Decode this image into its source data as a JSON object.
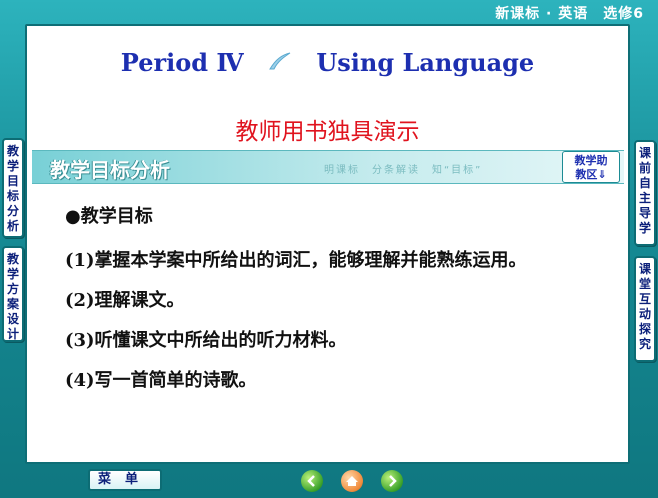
{
  "header": {
    "text": "新课标 · 英语　选修6"
  },
  "title": {
    "left": "Period Ⅳ",
    "right": "Using Language"
  },
  "subtitle": "教师用书独具演示",
  "banner": {
    "title": "教学目标分析",
    "sub": "明课标　分条解读　知“目标”",
    "button_line1": "教学助",
    "button_line2": "教区⇓"
  },
  "content": {
    "heading": "●教学目标",
    "items": [
      "(1)掌握本学案中所给出的词汇，能够理解并能熟练运用。",
      "(2)理解课文。",
      "(3)听懂课文中所给出的听力材料。",
      "(4)写一首简单的诗歌。"
    ]
  },
  "left_tabs": [
    {
      "label": "教学目标分析"
    },
    {
      "label": "教学方案设计"
    }
  ],
  "right_tabs": [
    {
      "label": "课前自主导学"
    },
    {
      "label": "课堂互动探究"
    }
  ],
  "footer": {
    "menu_label": "菜单"
  },
  "colors": {
    "frame": "#168a94",
    "title_blue": "#1d2fb0",
    "subtitle_red": "#e0131e"
  },
  "icons": [
    "back-icon",
    "home-icon",
    "forward-icon"
  ]
}
